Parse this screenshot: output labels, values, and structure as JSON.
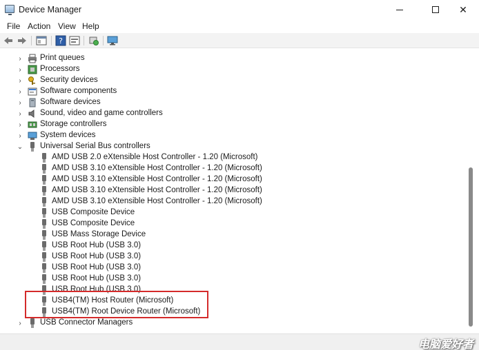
{
  "window": {
    "title": "Device Manager",
    "minimize_glyph": "—",
    "close_glyph": "✕"
  },
  "menu": {
    "items": [
      "File",
      "Action",
      "View",
      "Help"
    ]
  },
  "toolbar": {
    "icons": [
      "back-arrow-icon",
      "forward-arrow-icon",
      "properties-icon",
      "help-icon",
      "update-driver-icon",
      "scan-hardware-icon",
      "monitor-icon"
    ]
  },
  "tree": {
    "categories_top": [
      {
        "label": "Print queues",
        "icon": "printer-icon"
      },
      {
        "label": "Processors",
        "icon": "processor-icon"
      },
      {
        "label": "Security devices",
        "icon": "security-key-icon"
      },
      {
        "label": "Software components",
        "icon": "software-component-icon"
      },
      {
        "label": "Software devices",
        "icon": "software-device-icon"
      },
      {
        "label": "Sound, video and game controllers",
        "icon": "speaker-icon"
      },
      {
        "label": "Storage controllers",
        "icon": "storage-controller-icon"
      },
      {
        "label": "System devices",
        "icon": "system-device-icon"
      }
    ],
    "expanded_category": {
      "label": "Universal Serial Bus controllers",
      "icon": "usb-icon",
      "children": [
        "AMD USB 2.0 eXtensible Host Controller - 1.20 (Microsoft)",
        "AMD USB 3.10 eXtensible Host Controller - 1.20 (Microsoft)",
        "AMD USB 3.10 eXtensible Host Controller - 1.20 (Microsoft)",
        "AMD USB 3.10 eXtensible Host Controller - 1.20 (Microsoft)",
        "AMD USB 3.10 eXtensible Host Controller - 1.20 (Microsoft)",
        "USB Composite Device",
        "USB Composite Device",
        "USB Mass Storage Device",
        "USB Root Hub (USB 3.0)",
        "USB Root Hub (USB 3.0)",
        "USB Root Hub (USB 3.0)",
        "USB Root Hub (USB 3.0)",
        "USB Root Hub (USB 3.0)",
        "USB4(TM) Host Router (Microsoft)",
        "USB4(TM) Root Device Router (Microsoft)"
      ]
    },
    "categories_bottom": [
      {
        "label": "USB Connector Managers",
        "icon": "usb-icon"
      }
    ]
  },
  "annotation": {
    "highlight_color": "#d42a2a"
  },
  "watermark": {
    "text": "电脑爱好者"
  }
}
